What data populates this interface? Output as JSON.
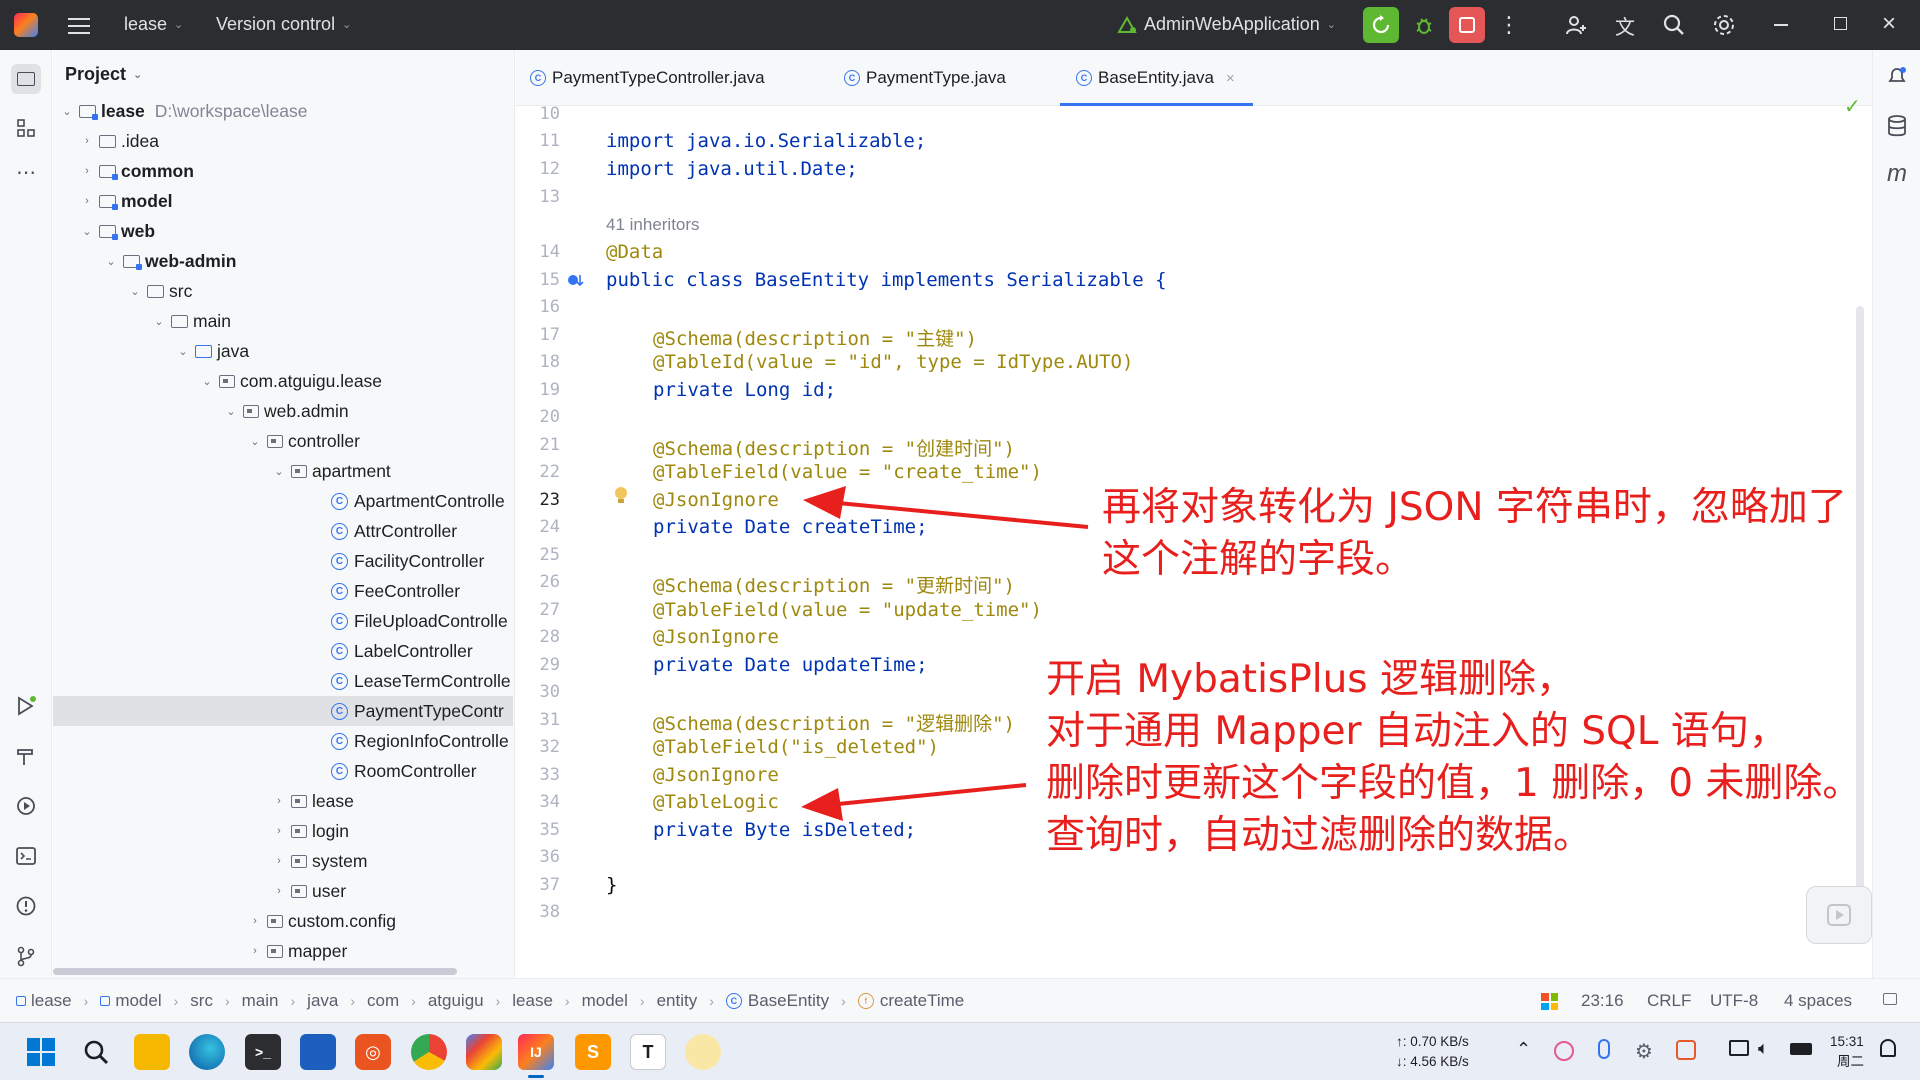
{
  "titlebar": {
    "project": "lease",
    "vcs": "Version control",
    "run_config": "AdminWebApplication",
    "colors": {
      "bg": "#2b2d30",
      "run_green": "#5fb832",
      "stop_red": "#e55656"
    }
  },
  "project_panel": {
    "title": "Project",
    "root_name": "lease",
    "root_path": "D:\\workspace\\lease",
    "items": [
      {
        "label": ".idea"
      },
      {
        "label": "common"
      },
      {
        "label": "model"
      },
      {
        "label": "web"
      },
      {
        "label": "web-admin"
      },
      {
        "label": "src"
      },
      {
        "label": "main"
      },
      {
        "label": "java"
      },
      {
        "label": "com.atguigu.lease"
      },
      {
        "label": "web.admin"
      },
      {
        "label": "controller"
      },
      {
        "label": "apartment"
      },
      {
        "label": "ApartmentControlle"
      },
      {
        "label": "AttrController"
      },
      {
        "label": "FacilityController"
      },
      {
        "label": "FeeController"
      },
      {
        "label": "FileUploadControlle"
      },
      {
        "label": "LabelController"
      },
      {
        "label": "LeaseTermControlle"
      },
      {
        "label": "PaymentTypeContr"
      },
      {
        "label": "RegionInfoControlle"
      },
      {
        "label": "RoomController"
      },
      {
        "label": "lease"
      },
      {
        "label": "login"
      },
      {
        "label": "system"
      },
      {
        "label": "user"
      },
      {
        "label": "custom.config"
      },
      {
        "label": "mapper"
      }
    ]
  },
  "tabs": [
    {
      "label": "PaymentTypeController.java"
    },
    {
      "label": "PaymentType.java"
    },
    {
      "label": "BaseEntity.java"
    }
  ],
  "editor": {
    "line_numbers": [
      "10",
      "11",
      "12",
      "13",
      "14",
      "15",
      "16",
      "17",
      "18",
      "19",
      "20",
      "21",
      "22",
      "23",
      "24",
      "25",
      "26",
      "27",
      "28",
      "29",
      "30",
      "31",
      "32",
      "33",
      "34",
      "35",
      "36",
      "37",
      "38"
    ],
    "inheritors_hint": "41 inheritors",
    "lines": {
      "l11": "import java.io.Serializable;",
      "l12": "import java.util.Date;",
      "l14": "@Data",
      "l15": "public class BaseEntity implements Serializable {",
      "l17": "@Schema(description = \"主键\")",
      "l18": "@TableId(value = \"id\", type = IdType.AUTO)",
      "l19": "private Long id;",
      "l21": "@Schema(description = \"创建时间\")",
      "l22": "@TableField(value = \"create_time\")",
      "l23": "@JsonIgnore",
      "l24": "private Date createTime;",
      "l26": "@Schema(description = \"更新时间\")",
      "l27": "@TableField(value = \"update_time\")",
      "l28": "@JsonIgnore",
      "l29": "private Date updateTime;",
      "l31": "@Schema(description = \"逻辑删除\")",
      "l32": "@TableField(\"is_deleted\")",
      "l33": "@JsonIgnore",
      "l34": "@TableLogic",
      "l35": "private Byte isDeleted;",
      "l37": "}"
    }
  },
  "annotations": {
    "note1": [
      "再将对象转化为 JSON 字符串时，忽略加了",
      "这个注解的字段。"
    ],
    "note2": [
      "开启 MybatisPlus 逻辑删除，",
      "对于通用 Mapper 自动注入的 SQL 语句，",
      "删除时更新这个字段的值，1 删除，0 未删除。",
      "查询时，自动过滤删除的数据。"
    ],
    "color": "#e8201d"
  },
  "statusbar": {
    "breadcrumb": [
      "lease",
      "model",
      "src",
      "main",
      "java",
      "com",
      "atguigu",
      "lease",
      "model",
      "entity",
      "BaseEntity",
      "createTime"
    ],
    "position": "23:16",
    "line_sep": "CRLF",
    "encoding": "UTF-8",
    "indent": "4 spaces"
  },
  "taskbar": {
    "net_up": "↑: 0.70 KB/s",
    "net_down": "↓: 4.56 KB/s",
    "time": "15:31",
    "day": "周二"
  }
}
